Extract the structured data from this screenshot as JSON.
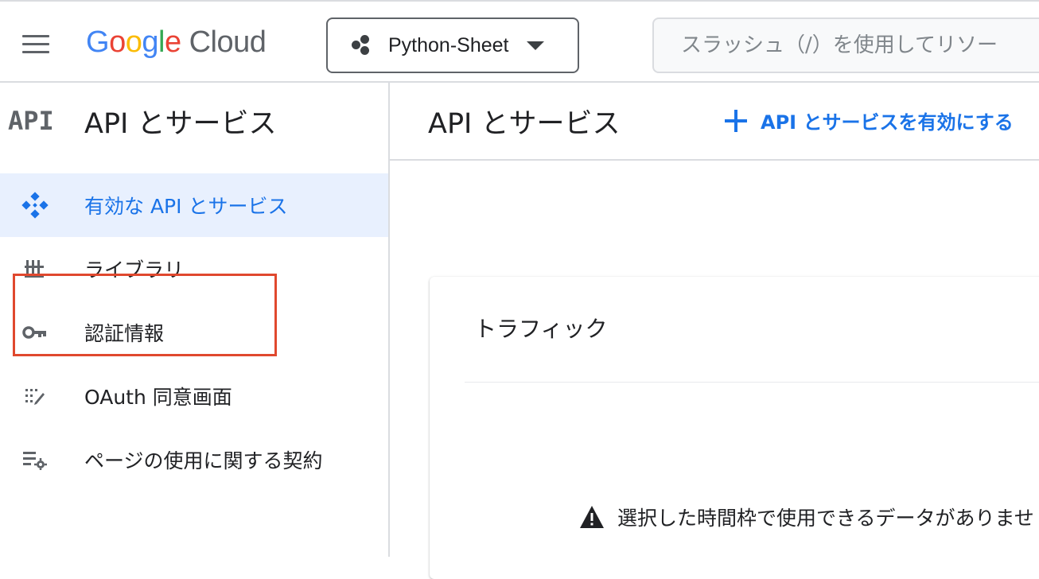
{
  "header": {
    "logo_letters": [
      "G",
      "o",
      "o",
      "g",
      "l",
      "e"
    ],
    "logo_product": "Cloud",
    "project_name": "Python-Sheet",
    "search_placeholder": "スラッシュ（/）を使用してリソー"
  },
  "sidebar": {
    "icon_text": "API",
    "title": "API とサービス",
    "items": [
      {
        "label": "有効な API とサービス",
        "icon": "api-diamond-icon",
        "active": true
      },
      {
        "label": "ライブラリ",
        "icon": "library-icon",
        "active": false
      },
      {
        "label": "認証情報",
        "icon": "key-icon",
        "active": false
      },
      {
        "label": "OAuth 同意画面",
        "icon": "oauth-consent-icon",
        "active": false,
        "highlighted": true
      },
      {
        "label": "ページの使用に関する契約",
        "icon": "page-usage-settings-icon",
        "active": false
      }
    ]
  },
  "main": {
    "title": "API とサービス",
    "enable_button": "API とサービスを有効にする",
    "card": {
      "title": "トラフィック",
      "empty_message": "選択した時間枠で使用できるデータがありませ"
    }
  },
  "colors": {
    "accent": "#1a73e8",
    "active_bg": "#e8f0fe",
    "highlight_border": "#e0482e"
  }
}
